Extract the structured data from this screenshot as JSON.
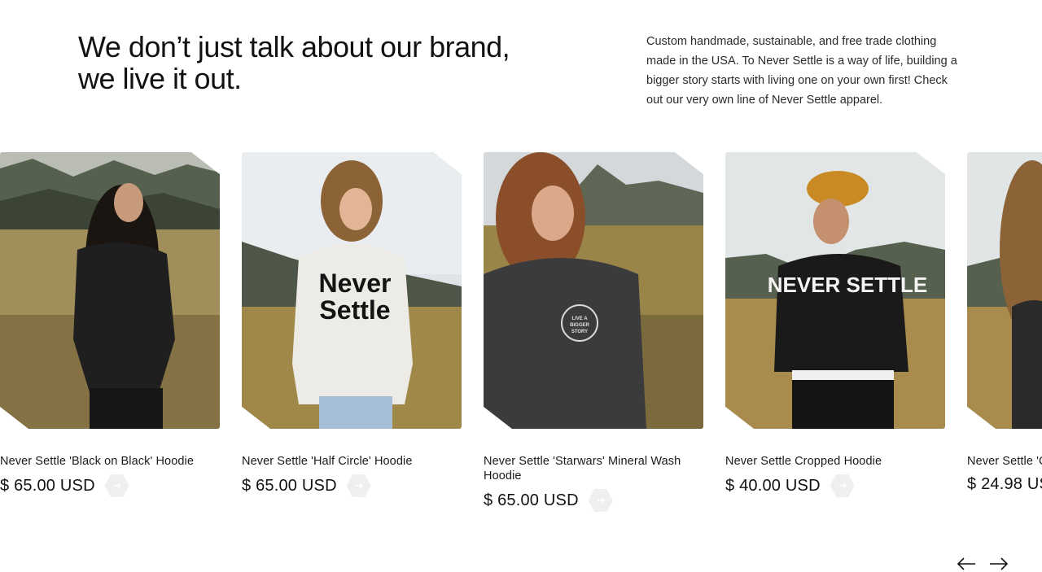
{
  "intro": {
    "headline_line1": "We don’t just talk about our brand,",
    "headline_line2": "we live it out.",
    "description": "Custom handmade, sustainable, and free trade clothing made in the USA. To Never Settle is a way of life, building a bigger story starts with living one on your own first! Check out our very own line of Never Settle apparel."
  },
  "products": [
    {
      "title": "Never Settle 'Black on Black' Hoodie",
      "price": "$ 65.00 USD",
      "garment_color": "#1c1c1c",
      "print_text": ""
    },
    {
      "title": "Never Settle 'Half Circle' Hoodie",
      "price": "$ 65.00 USD",
      "garment_color": "#ecebe6",
      "print_text": "Never Settle"
    },
    {
      "title": "Never Settle 'Starwars' Mineral Wash Hoodie",
      "price": "$ 65.00 USD",
      "garment_color": "#3b3b3d",
      "print_text": "LIVE A BIGGER STORY"
    },
    {
      "title": "Never Settle Cropped Hoodie",
      "price": "$ 40.00 USD",
      "garment_color": "#1a1a1a",
      "print_text": "NEVER SETTLE"
    },
    {
      "title": "Never Settle 'C",
      "price": "$ 24.98 US",
      "garment_color": "#2a2a2a",
      "print_text": ""
    }
  ],
  "icons": {
    "add": "arrow-right-icon",
    "prev": "arrow-left-icon",
    "next": "arrow-right-icon"
  }
}
